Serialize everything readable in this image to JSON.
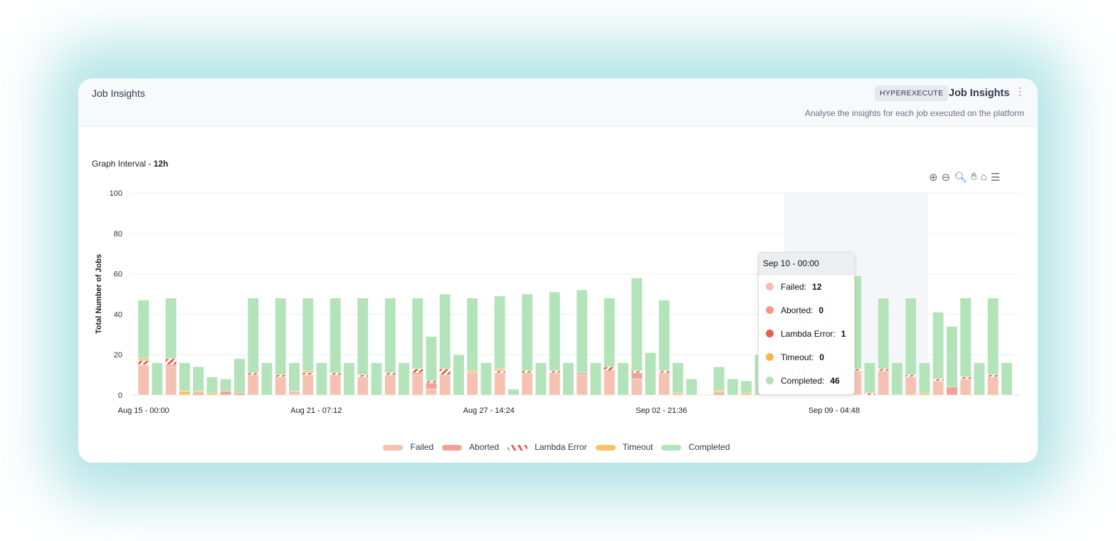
{
  "header": {
    "title": "Job Insights",
    "badge": "HYPEREXECUTE",
    "right_title": "Job Insights",
    "subtitle": "Analyse the insights for each job executed on the platform",
    "menu_icon": "kebab-icon"
  },
  "graph_interval": {
    "label": "Graph Interval - ",
    "value": "12h"
  },
  "toolbar": [
    "zoom-in-icon",
    "zoom-out-icon",
    "selection-zoom-icon",
    "pan-icon",
    "home-reset-icon",
    "menu-icon"
  ],
  "tooltip": {
    "title": "Sep 10 - 00:00",
    "rows": [
      {
        "label": "Failed:",
        "value": "12",
        "color": "#f5bfad"
      },
      {
        "label": "Aborted:",
        "value": "0",
        "color": "#f09a8a"
      },
      {
        "label": "Lambda Error:",
        "value": "1",
        "color": "#e4604b"
      },
      {
        "label": "Timeout:",
        "value": "0",
        "color": "#f6b84d"
      },
      {
        "label": "Completed:",
        "value": "46",
        "color": "#b2e3b9"
      }
    ]
  },
  "chart_data": {
    "type": "bar",
    "stacked": true,
    "title": "",
    "xlabel": "",
    "ylabel": "Total Number of Jobs",
    "ylim": [
      0,
      100
    ],
    "yticks": [
      "0",
      "20",
      "40",
      "60",
      "80",
      "100"
    ],
    "x_start": "Aug 15 - 00:00",
    "interval_hours": 12,
    "xticks": [
      "Aug 15 - 00:00",
      "Aug 21 - 07:12",
      "Aug 27 - 14:24",
      "Sep 02 - 21:36",
      "Sep 09 - 04:48"
    ],
    "highlighted_index": 52,
    "grid": true,
    "legend": "bottom",
    "series": [
      {
        "name": "Failed",
        "color": "#f5c2b1",
        "values": [
          15,
          0,
          14,
          0,
          0,
          0,
          0,
          0,
          10,
          0,
          9,
          2,
          10,
          0,
          10,
          0,
          9,
          0,
          10,
          0,
          10,
          3,
          10,
          0,
          11,
          0,
          11,
          0,
          11,
          0,
          11,
          0,
          10,
          0,
          11,
          0,
          8,
          0,
          11,
          0,
          0,
          0,
          0,
          0,
          0,
          0,
          10,
          0,
          10,
          0,
          10,
          0,
          12,
          0,
          12,
          0,
          9,
          0,
          7,
          0,
          8,
          0,
          9,
          0
        ]
      },
      {
        "name": "Aborted",
        "color": "#f1a196",
        "values": [
          0,
          0,
          1,
          0,
          1,
          0,
          2,
          1,
          0,
          0,
          0,
          0,
          0,
          0,
          0,
          0,
          0,
          0,
          0,
          0,
          1,
          3,
          0,
          0,
          0,
          0,
          0,
          0,
          0,
          0,
          0,
          0,
          1,
          0,
          1,
          0,
          3,
          0,
          0,
          0,
          0,
          0,
          1,
          0,
          0,
          0,
          0,
          0,
          0,
          0,
          0,
          0,
          0,
          0,
          0,
          0,
          0,
          0,
          0,
          4,
          0,
          0,
          0,
          0
        ]
      },
      {
        "name": "Lambda Error",
        "color": "#e4604b",
        "pattern": "hatched",
        "values": [
          2,
          0,
          3,
          0,
          0,
          0,
          0,
          0,
          1,
          0,
          1,
          0,
          1,
          0,
          1,
          0,
          1,
          0,
          1,
          0,
          2,
          1,
          3,
          0,
          0,
          0,
          1,
          0,
          1,
          0,
          1,
          0,
          0,
          0,
          2,
          0,
          1,
          0,
          1,
          0,
          0,
          0,
          0,
          0,
          0,
          0,
          1,
          0,
          1,
          0,
          1,
          0,
          1,
          1,
          1,
          0,
          1,
          0,
          1,
          0,
          1,
          0,
          1,
          0
        ]
      },
      {
        "name": "Timeout",
        "color": "#f7c26a",
        "values": [
          1,
          0,
          0,
          2,
          1,
          1,
          0,
          0,
          0,
          0,
          0,
          0,
          1,
          0,
          0,
          0,
          0,
          0,
          0,
          0,
          0,
          0,
          0,
          0,
          1,
          0,
          1,
          0,
          0,
          0,
          0,
          0,
          0,
          0,
          0,
          0,
          0,
          0,
          0,
          1,
          0,
          0,
          1,
          0,
          1,
          0,
          0,
          0,
          0,
          0,
          0,
          0,
          0,
          0,
          0,
          0,
          0,
          1,
          0,
          0,
          0,
          0,
          0,
          0
        ]
      },
      {
        "name": "Completed",
        "color": "#b3e3b9",
        "values": [
          29,
          16,
          30,
          14,
          12,
          8,
          6,
          17,
          37,
          16,
          38,
          14,
          36,
          16,
          37,
          16,
          38,
          16,
          37,
          16,
          35,
          22,
          37,
          20,
          36,
          16,
          36,
          3,
          38,
          16,
          39,
          16,
          41,
          16,
          34,
          16,
          46,
          21,
          35,
          15,
          8,
          0,
          12,
          8,
          6,
          20,
          37,
          16,
          37,
          16,
          37,
          16,
          46,
          15,
          35,
          16,
          38,
          15,
          33,
          30,
          39,
          16,
          38,
          16
        ]
      }
    ]
  }
}
